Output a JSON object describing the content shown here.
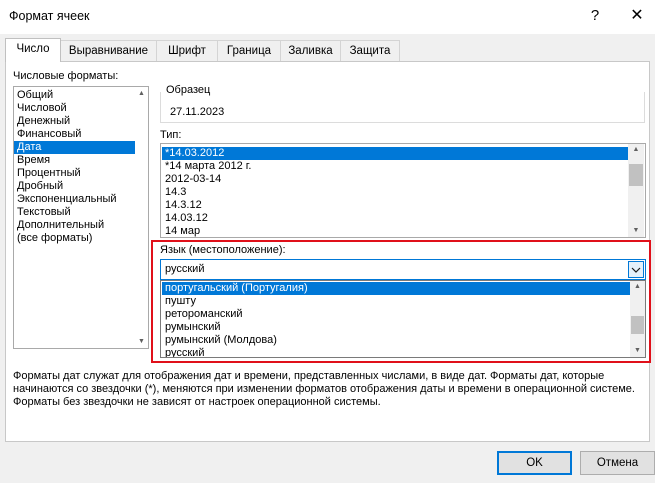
{
  "window": {
    "title": "Формат ячеек",
    "help_glyph": "?",
    "close_glyph": "✕"
  },
  "tabs": [
    {
      "label": "Число",
      "active": true
    },
    {
      "label": "Выравнивание"
    },
    {
      "label": "Шрифт"
    },
    {
      "label": "Граница"
    },
    {
      "label": "Заливка"
    },
    {
      "label": "Защита"
    }
  ],
  "category": {
    "label": "Числовые форматы:",
    "items": [
      "Общий",
      "Числовой",
      "Денежный",
      "Финансовый",
      "Дата",
      "Время",
      "Процентный",
      "Дробный",
      "Экспоненциальный",
      "Текстовый",
      "Дополнительный",
      "(все форматы)"
    ],
    "selected": "Дата"
  },
  "sample": {
    "label": "Образец",
    "value": "27.11.2023"
  },
  "type": {
    "label": "Тип:",
    "items": [
      "*14.03.2012",
      "*14 марта 2012 г.",
      "2012-03-14",
      "14.3",
      "14.3.12",
      "14.03.12",
      "14 мар"
    ],
    "selected": "*14.03.2012"
  },
  "locale": {
    "label": "Язык (местоположение):",
    "value": "русский",
    "options": [
      "португальский (Португалия)",
      "пушту",
      "ретороманский",
      "румынский",
      "румынский (Молдова)",
      "русский"
    ],
    "highlighted": "португальский (Португалия)"
  },
  "description": "Форматы дат служат для отображения дат и времени, представленных числами, в виде дат. Форматы дат, которые начинаются со звездочки (*), меняются при изменении форматов отображения даты и времени в операционной системе. Форматы без звездочки не зависят от настроек операционной системы.",
  "buttons": {
    "ok": "OK",
    "cancel": "Отмена"
  },
  "colors": {
    "selection": "#0078d7",
    "highlight_frame": "#e0101a"
  }
}
